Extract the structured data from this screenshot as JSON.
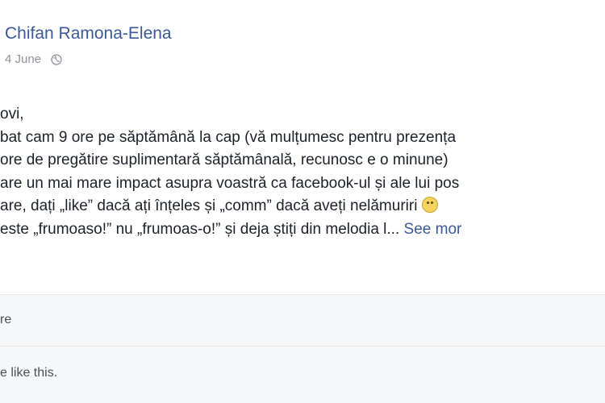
{
  "post": {
    "author": "Chifan Ramona-Elena",
    "date": "4 June",
    "privacy_icon": "globe-icon",
    "lines": [
      "ovi,",
      "bat cam 9 ore pe săptămână la cap (vă mulțumesc pentru prezența ",
      " ore de pregătire suplimentară săptămânală, recunosc e o minune) ",
      " are un mai mare impact asupra voastră ca facebook-ul și ale lui pos",
      "are, dați „like” dacă ați înțeles și „comm” dacă aveți nelămuriri ",
      "este „frumoaso!” nu „frumoas-o!” și deja știți din melodia l... "
    ],
    "emoji_icon": "smiley-emoji-icon",
    "see_more": "See mor"
  },
  "actions": {
    "label": "re"
  },
  "likes": {
    "text": "e like this."
  },
  "colors": {
    "link": "#3b5998",
    "meta": "#90949c",
    "footer_bg": "#f6f7f9",
    "divider": "#e5e5e5"
  }
}
